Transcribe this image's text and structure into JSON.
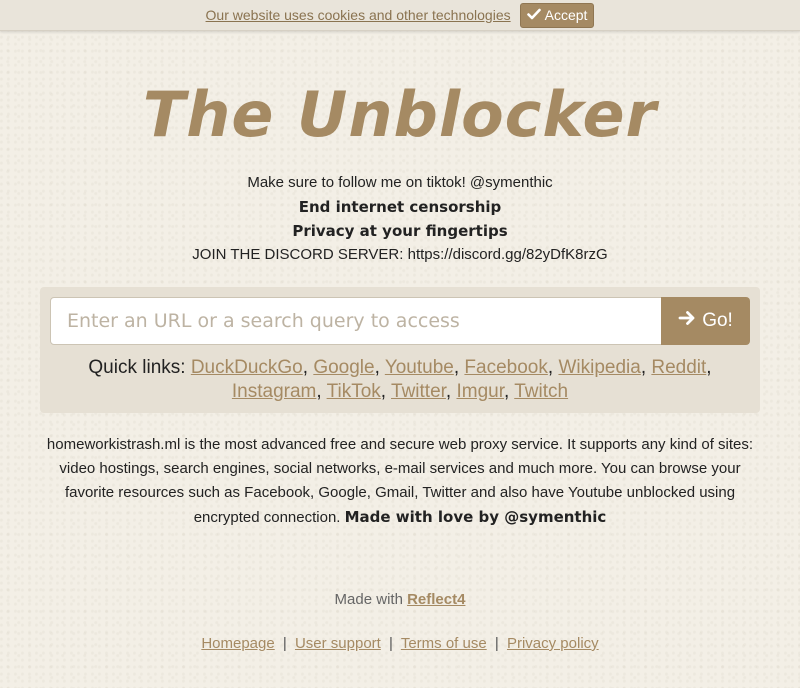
{
  "cookie": {
    "message": "Our website uses cookies and other technologies",
    "accept_label": "Accept"
  },
  "logo": "The Unblocker",
  "taglines": {
    "tiktok": "Make sure to follow me on tiktok! @symenthic",
    "censorship": "End internet censorship",
    "privacy": "Privacy at your fingertips",
    "discord": "JOIN THE DISCORD SERVER: https://discord.gg/82yDfK8rzG"
  },
  "search": {
    "placeholder": "Enter an URL or a search query to access",
    "go_label": "Go!"
  },
  "quick_links": {
    "label": "Quick links:",
    "items": [
      "DuckDuckGo",
      "Google",
      "Youtube",
      "Facebook",
      "Wikipedia",
      "Reddit",
      "Instagram",
      "TikTok",
      "Twitter",
      "Imgur",
      "Twitch"
    ]
  },
  "description": {
    "text": "homeworkistrash.ml is the most advanced free and secure web proxy service. It supports any kind of sites: video hostings, search engines, social networks, e-mail services and much more. You can browse your favorite resources such as Facebook, Google, Gmail, Twitter and also have Youtube unblocked using encrypted connection.",
    "signature": "Made with love by @symenthic"
  },
  "made_with": {
    "label": "Made with",
    "link": "Reflect4"
  },
  "footer": {
    "links": [
      "Homepage",
      "User support",
      "Terms of use",
      "Privacy policy"
    ],
    "separator": "|"
  },
  "colors": {
    "accent": "#a58a63",
    "background": "#f3efe6",
    "panel": "#e6e0d4"
  },
  "icons": {
    "accept": "check-icon",
    "go": "arrow-right-icon"
  }
}
